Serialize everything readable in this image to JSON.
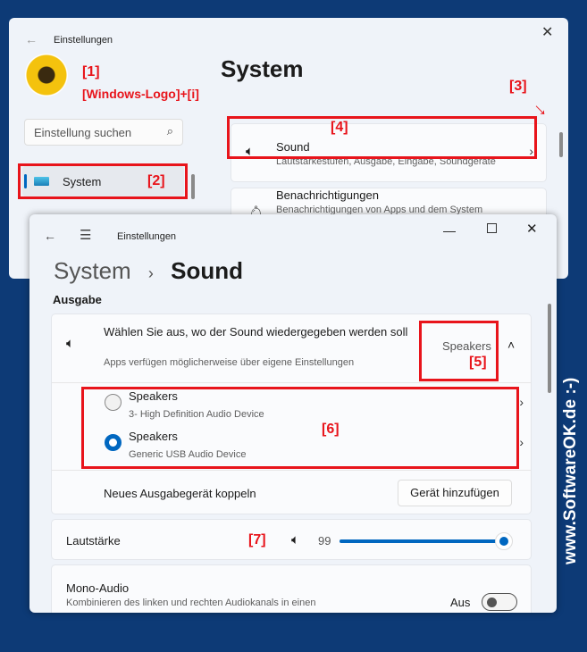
{
  "back_window": {
    "title": "Einstellungen",
    "annotation_1": "[1]",
    "shortcut": "[Windows-Logo]+[i]",
    "search_placeholder": "Einstellung suchen",
    "nav_item": "System",
    "annotation_2": "[2]",
    "page_title": "System",
    "annotation_3": "[3]",
    "items": [
      {
        "title": "Sound",
        "subtitle": "Lautstärkestufen, Ausgabe, Eingabe, Soundgeräte",
        "icon": "speaker-icon"
      },
      {
        "title": "Benachrichtigungen",
        "subtitle": "Benachrichtigungen von Apps und dem System",
        "icon": "bell-icon"
      }
    ],
    "annotation_4": "[4]"
  },
  "front_window": {
    "title": "Einstellungen",
    "breadcrumb_parent": "System",
    "breadcrumb_current": "Sound",
    "section": "Ausgabe",
    "output": {
      "title": "Wählen Sie aus, wo der Sound wiedergegeben werden soll",
      "subtitle": "Apps verfügen möglicherweise über eigene Einstellungen",
      "selected": "Speakers",
      "annotation_5": "[5]"
    },
    "devices": [
      {
        "name": "Speakers",
        "detail": "3- High Definition Audio Device",
        "selected": false
      },
      {
        "name": "Speakers",
        "detail": "Generic USB Audio Device",
        "selected": true
      }
    ],
    "annotation_6": "[6]",
    "pair_label": "Neues Ausgabegerät koppeln",
    "pair_button": "Gerät hinzufügen",
    "volume_label": "Lautstärke",
    "annotation_7": "[7]",
    "volume_value": "99",
    "volume_percent": 99,
    "mono_title": "Mono-Audio",
    "mono_subtitle": "Kombinieren des linken und rechten Audiokanals in einen",
    "mono_state": "Aus"
  },
  "watermark": "www.SoftwareOK.de :-)",
  "colors": {
    "accent": "#0067c0",
    "annotation": "#e8141b",
    "background": "#0d3a76"
  }
}
